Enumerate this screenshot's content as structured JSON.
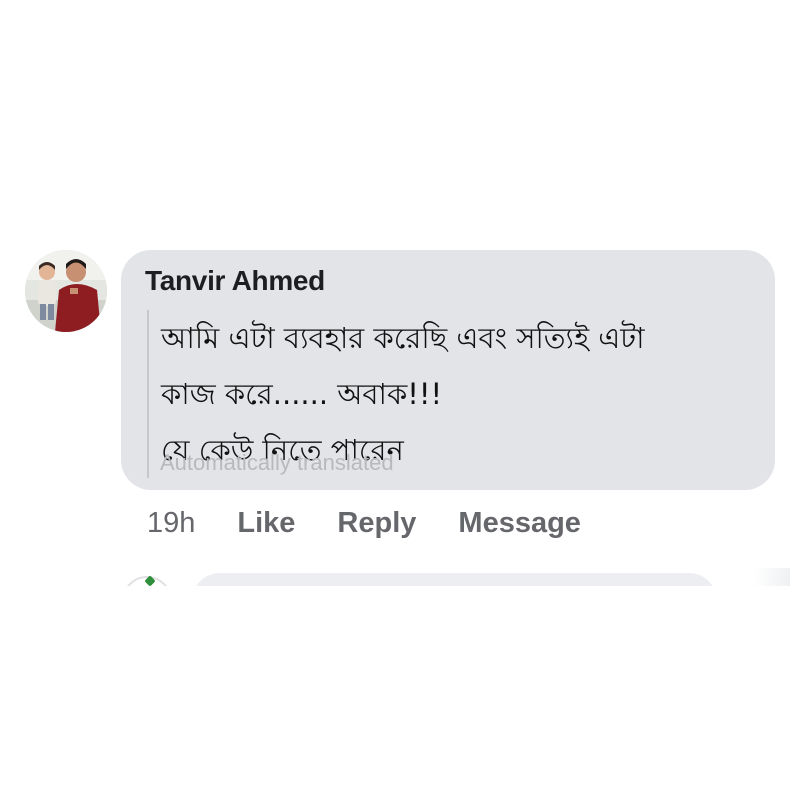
{
  "comment": {
    "author": "Tanvir Ahmed",
    "lines": [
      "আমি এটা ব্যবহার করেছি এবং সত্যিই এটা",
      "কাজ করে...... অবাক!!!",
      "যে কেউ নিতে পারেন"
    ],
    "translation_note": "Automatically translated",
    "time": "19h",
    "actions": {
      "like": "Like",
      "reply": "Reply",
      "message": "Message"
    }
  },
  "colors": {
    "bubble": "#e3e4e8",
    "action_text": "#65676b",
    "author_text": "#1c1e21"
  },
  "icons": {
    "avatar": "profile-photo"
  }
}
